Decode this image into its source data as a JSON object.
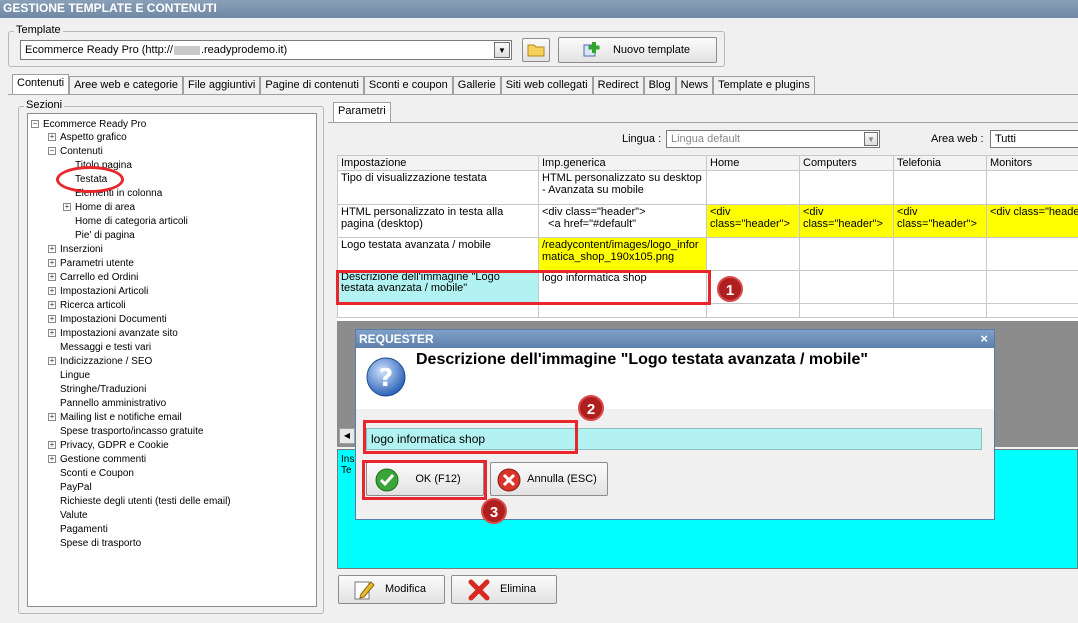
{
  "window": {
    "title": "GESTIONE TEMPLATE E CONTENUTI"
  },
  "template": {
    "label": "Template",
    "selected": "Ecommerce Ready Pro (http://",
    "selected_tail": ".readyprodemo.it)",
    "new_button": "Nuovo template"
  },
  "tabs": [
    "Contenuti",
    "Aree web e categorie",
    "File aggiuntivi",
    "Pagine di contenuti",
    "Sconti e coupon",
    "Gallerie",
    "Siti web collegati",
    "Redirect",
    "Blog",
    "News",
    "Template e plugins"
  ],
  "sections": {
    "label": "Sezioni",
    "root": "Ecommerce Ready Pro",
    "items": [
      {
        "label": "Aspetto grafico",
        "expander": "+"
      },
      {
        "label": "Contenuti",
        "expander": "−"
      },
      {
        "label": "Titolo pagina",
        "expander": ""
      },
      {
        "label": "Testata",
        "expander": ""
      },
      {
        "label": "Elementi in colonna",
        "expander": ""
      },
      {
        "label": "Home di area",
        "expander": "+"
      },
      {
        "label": "Home di categoria articoli",
        "expander": ""
      },
      {
        "label": "Pie' di pagina",
        "expander": ""
      },
      {
        "label": "Inserzioni",
        "expander": "+"
      },
      {
        "label": "Parametri utente",
        "expander": "+"
      },
      {
        "label": "Carrello ed Ordini",
        "expander": "+"
      },
      {
        "label": "Impostazioni Articoli",
        "expander": "+"
      },
      {
        "label": "Ricerca articoli",
        "expander": "+"
      },
      {
        "label": "Impostazioni Documenti",
        "expander": "+"
      },
      {
        "label": "Impostazioni avanzate sito",
        "expander": "+"
      },
      {
        "label": "Messaggi e testi vari",
        "expander": ""
      },
      {
        "label": "Indicizzazione / SEO",
        "expander": "+"
      },
      {
        "label": "Lingue",
        "expander": ""
      },
      {
        "label": "Stringhe/Traduzioni",
        "expander": ""
      },
      {
        "label": "Pannello amministrativo",
        "expander": ""
      },
      {
        "label": "Mailing list e notifiche email",
        "expander": "+"
      },
      {
        "label": "Spese trasporto/incasso gratuite",
        "expander": ""
      },
      {
        "label": "Privacy, GDPR e Cookie",
        "expander": "+"
      },
      {
        "label": "Gestione commenti",
        "expander": "+"
      },
      {
        "label": "Sconti e Coupon",
        "expander": ""
      },
      {
        "label": "PayPal",
        "expander": ""
      },
      {
        "label": "Richieste degli utenti (testi delle email)",
        "expander": ""
      },
      {
        "label": "Valute",
        "expander": ""
      },
      {
        "label": "Pagamenti",
        "expander": ""
      },
      {
        "label": "Spese di trasporto",
        "expander": ""
      }
    ]
  },
  "params": {
    "tab": "Parametri",
    "lingua_label": "Lingua :",
    "lingua_value": "Lingua default",
    "area_label": "Area web :",
    "area_value": "Tutti"
  },
  "grid": {
    "headers": [
      "Impostazione",
      "Imp.generica",
      "Home",
      "Computers",
      "Telefonia",
      "Monitors"
    ],
    "rows": [
      {
        "name": "Tipo di visualizzazione testata",
        "generic": "HTML personalizzato su desktop - Avanzata su mobile",
        "home": "",
        "computers": "",
        "telefonia": "",
        "monitors": ""
      },
      {
        "name": "HTML personalizzato in testa alla pagina (desktop)",
        "generic": "<div class=\"header\">\n  <a href=\"#default\"",
        "home": "<div class=\"header\">",
        "computers": "<div class=\"header\">",
        "telefonia": "<div class=\"header\">",
        "monitors": "<div class=\"header\">"
      },
      {
        "name": "Logo testata avanzata / mobile",
        "generic": "/readycontent/images/logo_informatica_shop_190x105.png",
        "home": "",
        "computers": "",
        "telefonia": "",
        "monitors": ""
      },
      {
        "name": "Descrizione dell'immagine \"Logo testata avanzata / mobile\"",
        "generic": "logo informatica shop",
        "home": "",
        "computers": "",
        "telefonia": "",
        "monitors": ""
      }
    ]
  },
  "bottom_panel": {
    "line1": "Ins",
    "line2": "Te"
  },
  "buttons": {
    "modifica": "Modifica",
    "elimina": "Elimina"
  },
  "dialog": {
    "title": "REQUESTER",
    "close": "×",
    "heading": "Descrizione dell'immagine \"Logo testata avanzata / mobile\"",
    "input_value": "logo informatica shop",
    "ok": "OK (F12)",
    "cancel": "Annulla (ESC)"
  },
  "callouts": [
    "1",
    "2",
    "3"
  ],
  "colors": {
    "highlight": "#ffff00",
    "selected_cell": "#b3f2f2",
    "panel": "#00ffff",
    "annotation": "#e8262b"
  }
}
